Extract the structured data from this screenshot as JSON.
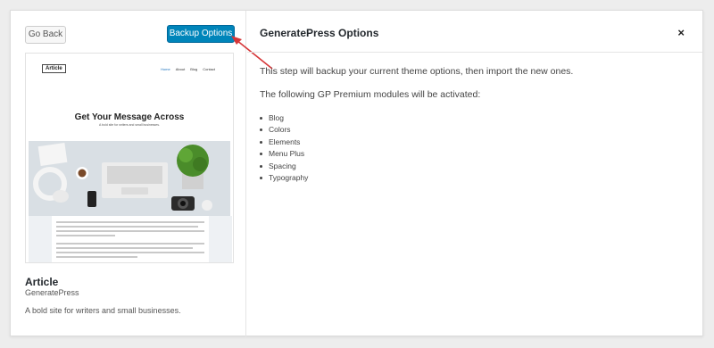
{
  "left": {
    "back_label": "Go Back",
    "backup_label": "Backup Options",
    "preview": {
      "logo": "Article",
      "nav": [
        "Home",
        "About",
        "Blog",
        "Contact"
      ],
      "headline": "Get Your Message Across",
      "subline": "A bold site for writers and small businesses."
    },
    "theme_name": "Article",
    "theme_author": "GeneratePress",
    "theme_description": "A bold site for writers and small businesses."
  },
  "right": {
    "title": "GeneratePress Options",
    "close_label": "×",
    "paragraph1": "This step will backup your current theme options, then import the new ones.",
    "paragraph2": "The following GP Premium modules will be activated:",
    "modules": [
      "Blog",
      "Colors",
      "Elements",
      "Menu Plus",
      "Spacing",
      "Typography"
    ]
  },
  "colors": {
    "accent": "#0085ba",
    "arrow": "#d63638"
  }
}
